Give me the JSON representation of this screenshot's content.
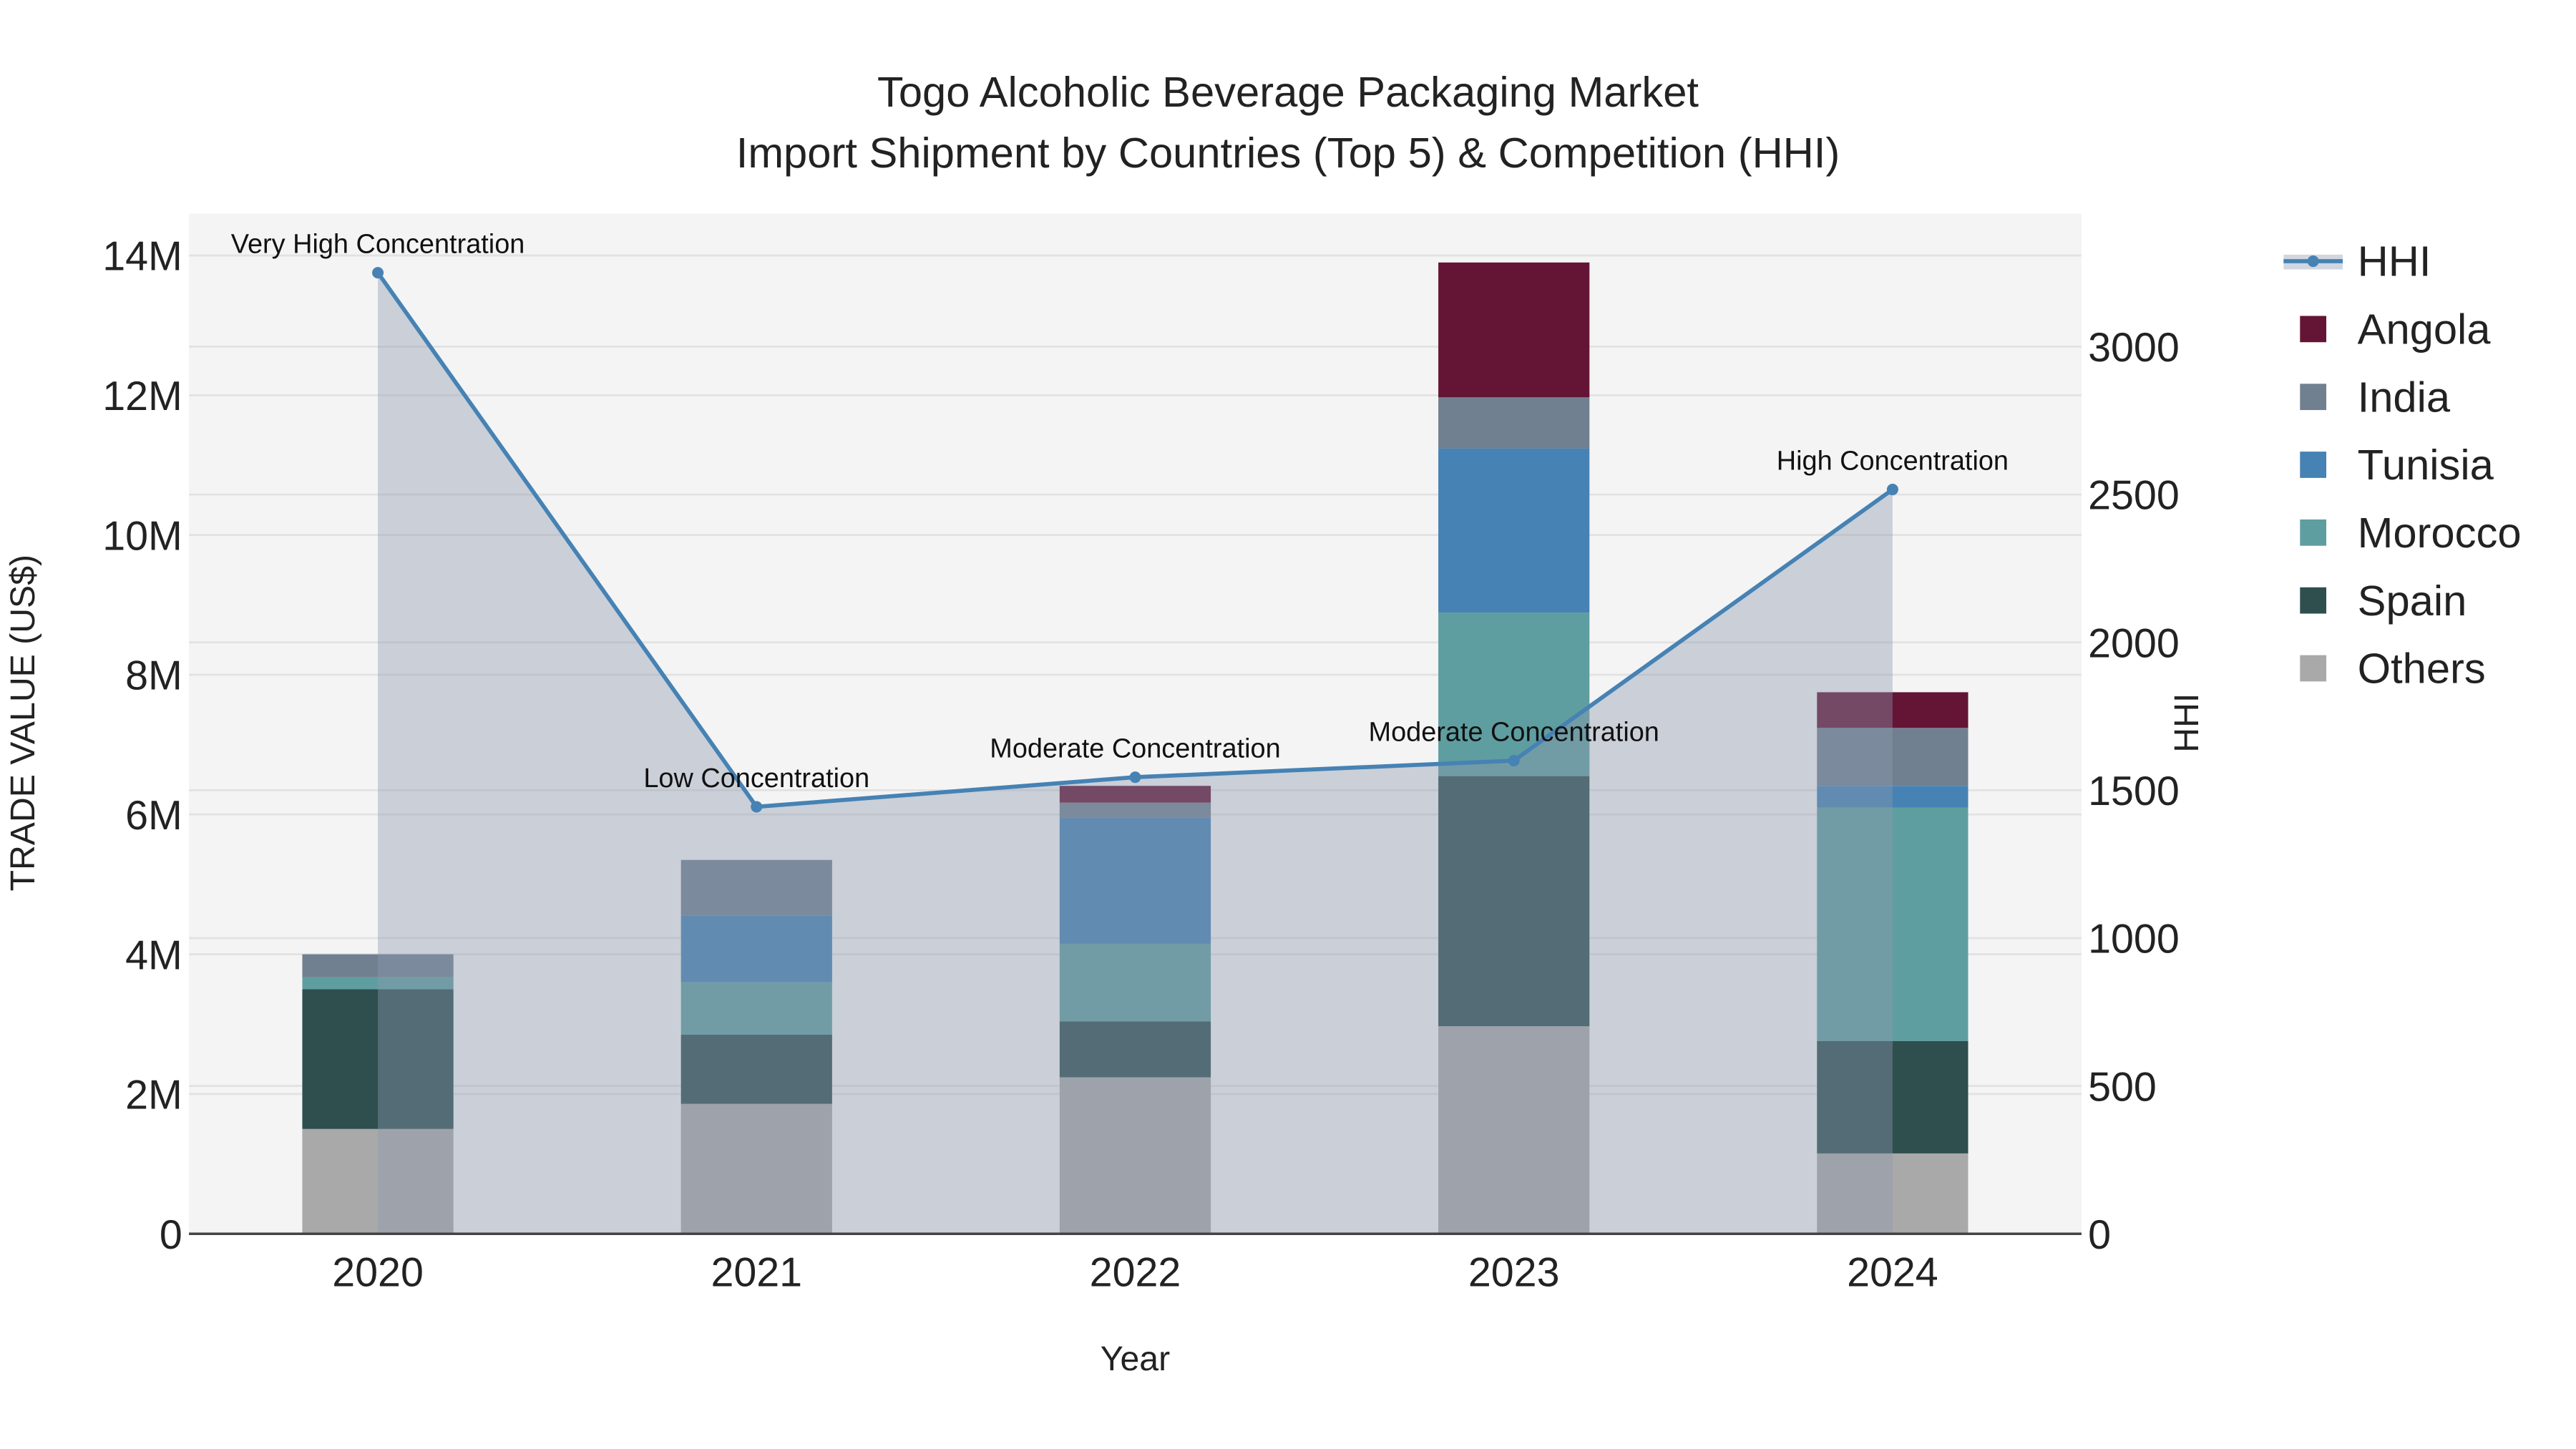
{
  "chart_data": {
    "type": "bar",
    "title": "Togo Alcoholic Beverage Packaging Market",
    "subtitle": "Import Shipment by Countries (Top 5) & Competition (HHI)",
    "xlabel": "Year",
    "ylabel": "TRADE VALUE (US$)",
    "y2label": "HHI",
    "categories": [
      "2020",
      "2021",
      "2022",
      "2023",
      "2024"
    ],
    "ylim": [
      0,
      14600000
    ],
    "y_ticks": [
      0,
      2000000,
      4000000,
      6000000,
      8000000,
      10000000,
      12000000,
      14000000
    ],
    "y_tick_labels": [
      "0",
      "2M",
      "4M",
      "6M",
      "8M",
      "10M",
      "12M",
      "14M"
    ],
    "y2lim": [
      0,
      3450
    ],
    "y2_ticks": [
      0,
      500,
      1000,
      1500,
      2000,
      2500,
      3000
    ],
    "y2_tick_labels": [
      "0",
      "500",
      "1000",
      "1500",
      "2000",
      "2500",
      "3000"
    ],
    "stacked": true,
    "series": [
      {
        "name": "Others",
        "color": "#a9a9a9",
        "values": [
          1500000,
          1860000,
          2240000,
          2970000,
          1150000
        ]
      },
      {
        "name": "Spain",
        "color": "#2f4f4f",
        "values": [
          2000000,
          990000,
          800000,
          3580000,
          1610000
        ]
      },
      {
        "name": "Morocco",
        "color": "#5f9ea0",
        "values": [
          170000,
          750000,
          1110000,
          2340000,
          3340000
        ]
      },
      {
        "name": "Tunisia",
        "color": "#4682b4",
        "values": [
          0,
          950000,
          1810000,
          2350000,
          310000
        ]
      },
      {
        "name": "India",
        "color": "#708090",
        "values": [
          330000,
          800000,
          210000,
          730000,
          830000
        ]
      },
      {
        "name": "Angola",
        "color": "#641434",
        "values": [
          0,
          0,
          240000,
          1930000,
          510000
        ]
      }
    ],
    "line": {
      "name": "HHI",
      "color": "#4682b4",
      "values": [
        3250,
        1444,
        1544,
        1600,
        2517
      ],
      "annotations": [
        "Very High Concentration",
        "Low Concentration",
        "Moderate Concentration",
        "Moderate Concentration",
        "High Concentration"
      ]
    },
    "legend": {
      "placement": "right",
      "order": [
        "HHI",
        "Angola",
        "India",
        "Tunisia",
        "Morocco",
        "Spain",
        "Others"
      ]
    },
    "grid": true
  }
}
